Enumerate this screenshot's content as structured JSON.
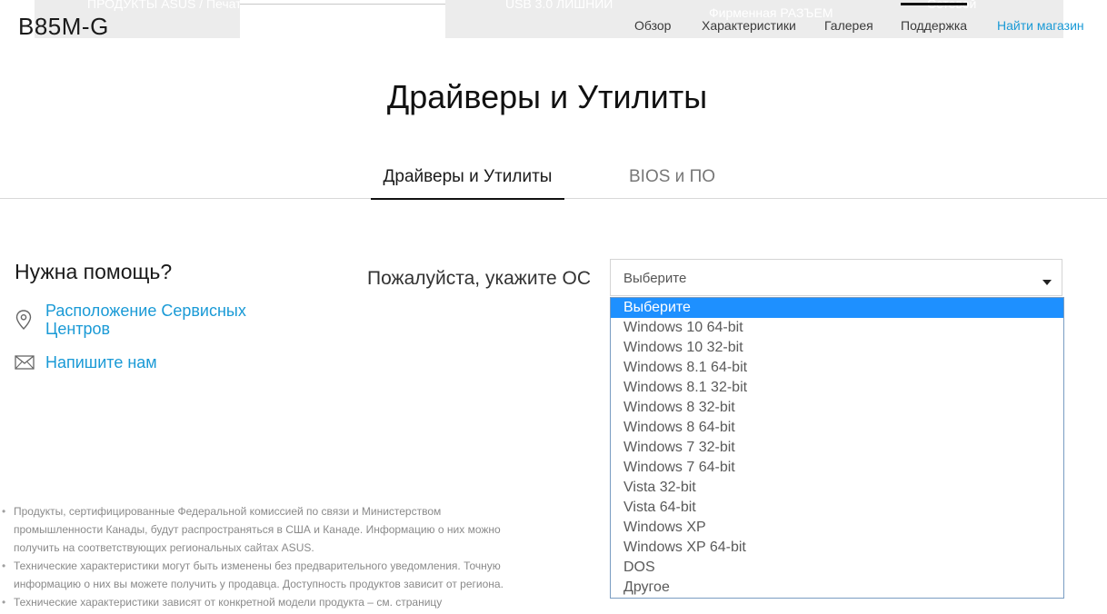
{
  "header": {
    "product_name": "B85M-G",
    "ghost_texts": [
      "ПРОДУКТЫ ASUS / Печать",
      "USB 3.0 ЛИШНИЙ",
      "Фирменная РАЗЪЕМ",
      "Сетевой"
    ],
    "nav": [
      {
        "label": "Обзор"
      },
      {
        "label": "Характеристики"
      },
      {
        "label": "Галерея"
      },
      {
        "label": "Поддержка",
        "active": true
      },
      {
        "label": "Найти магазин"
      }
    ]
  },
  "page_title": "Драйверы и Утилиты",
  "tabs": {
    "drivers": "Драйверы и Утилиты",
    "bios": "BIOS и ПО"
  },
  "help": {
    "title": "Нужна помощь?",
    "service_centers": "Расположение Сервисных Центров",
    "contact": "Напишите нам"
  },
  "os_picker": {
    "label": "Пожалуйста, укажите ОС",
    "selected": "Выберите",
    "options": [
      "Выберите",
      "Windows 10 64-bit",
      "Windows 10 32-bit",
      "Windows 8.1 64-bit",
      "Windows 8.1 32-bit",
      "Windows 8 32-bit",
      "Windows 8 64-bit",
      "Windows 7 32-bit",
      "Windows 7 64-bit",
      "Vista 32-bit",
      "Vista 64-bit",
      "Windows XP",
      "Windows XP 64-bit",
      "DOS",
      "Другое"
    ]
  },
  "notes": [
    "Продукты, сертифицированные Федеральной комиссией по связи и Министерством промышленности Канады, будут распространяться в США и Канаде. Информацию о них можно получить на соответствующих региональных сайтах ASUS.",
    "Технические характеристики могут быть изменены без предварительного уведомления. Точную информацию о них вы можете получить у продавца. Доступность продуктов зависит от региона.",
    "Технические характеристики зависят от конкретной модели продукта – см. страницу"
  ],
  "colors": {
    "link": "#1a9ad6",
    "selected_option": "#1e90ff"
  }
}
